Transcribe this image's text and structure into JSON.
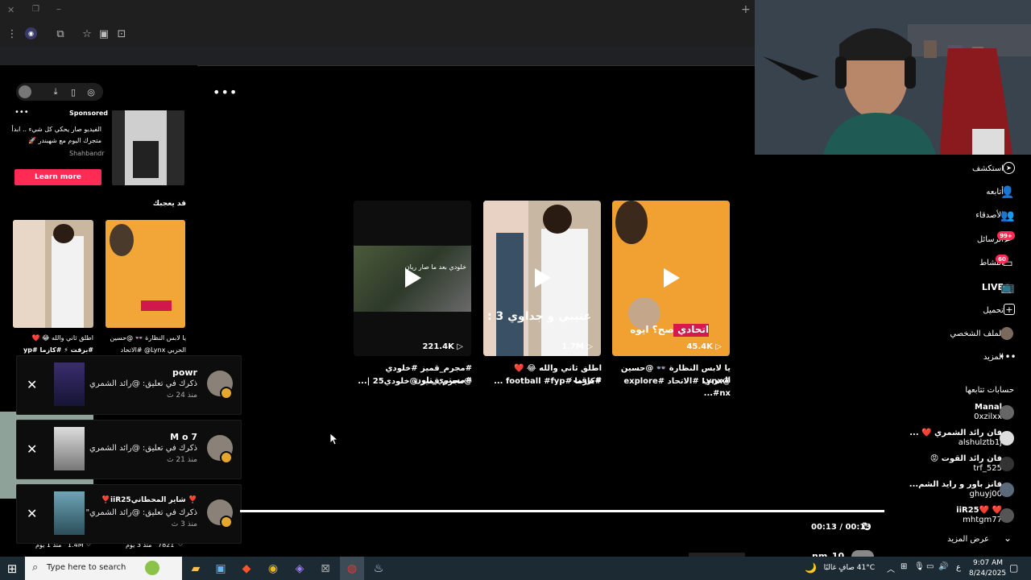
{
  "browser": {
    "toolbar_icons": [
      "menu-dots-icon",
      "profile-icon",
      "extensions-icon",
      "star-icon",
      "tab-search-icon",
      "screenshot-icon"
    ]
  },
  "left": {
    "sponsored_label": "Sponsored",
    "ad_text_line1": "الفيديو صار يحكي كل شيء .. ابدأ",
    "ad_text_line2": "متجرك اليوم مع شهبندر 🚀",
    "ad_brand": "Shahbandr",
    "learn_more": "Learn more",
    "you_may_like": "قد يعجبك",
    "small_cards": [
      {
        "caption_line1": "اطلق ثاني والله 😂 ❤️",
        "caption_line2": "#برقت ⚡ #كازما #yp"
      },
      {
        "caption_line1": "يا لابس النظارة 👓 @حسين",
        "caption_line2": "الحربي Lynx@ #الاتحاد"
      }
    ],
    "bottom_stats": [
      {
        "count": "1.4M",
        "age": "منذ 1 يوم"
      },
      {
        "count": "7821",
        "age": "منذ 3 يوم"
      }
    ]
  },
  "notifications": [
    {
      "name": "powr",
      "message": "ذكرك في تعليق: @رائد الشمري",
      "time": "منذ 24 ث"
    },
    {
      "name": "M o 7",
      "message": "ذكرك في تعليق: @رائد الشمري",
      "time": "منذ 21 ث"
    },
    {
      "name": "❣️iiR25شاير المحطاني ❣️",
      "message": "ذكرك في تعليق: @رائد الشمري\"",
      "time": "منذ 3 ث"
    }
  ],
  "videos": [
    {
      "views": "221.4K",
      "caption_line1": "#مجرم_قميز #خلودي #مستري_تاون",
      "caption_line2": "@مجرم قميز @خلودي25 |...",
      "overlay": "خلودي بعد ما صار ريان"
    },
    {
      "views": "1.7M",
      "caption_line1": "اطلق ثاني والله 😂 ❤️ #برقت⚡",
      "caption_line2": "#كازما #football #fyp ...",
      "overlay": "عتيبي و جداوي 3 :"
    },
    {
      "views": "45.4K",
      "caption_line1": "يا لابس النظارة 👓 @حسين الحربي",
      "caption_line2": "@Lynx #الاتحاد #explore #nx...",
      "overlay": "اتحادي صح؟ ايوه"
    }
  ],
  "player": {
    "time": "00:13 / 00:13",
    "bottom_name": "nm_10"
  },
  "nav": [
    {
      "label": "استكشف",
      "icon": "compass-icon"
    },
    {
      "label": "أتابعه",
      "icon": "user-follow-icon"
    },
    {
      "label": "الأصدقاء",
      "icon": "friends-icon"
    },
    {
      "label": "الرسائل",
      "icon": "messages-icon",
      "badge": "99+"
    },
    {
      "label": "النشاط",
      "icon": "activity-icon",
      "badge": "60"
    },
    {
      "label": "LIVE",
      "icon": "live-icon"
    },
    {
      "label": "تحميل",
      "icon": "upload-icon"
    },
    {
      "label": "الملف الشخصي",
      "icon": "profile-avatar-icon"
    },
    {
      "label": "المزيد",
      "icon": "more-icon"
    }
  ],
  "following": {
    "title": "حسابات تتابعها",
    "accounts": [
      {
        "name": "Manal",
        "user": "0xzilxx"
      },
      {
        "name": "فان رائد الشمري ❤️ ...",
        "user": "alshulztb1j"
      },
      {
        "name": "فان رائد القوت 😡",
        "user": "trf_525"
      },
      {
        "name": "فانز باور و رايد الشم...",
        "user": "ghuyj00"
      },
      {
        "name": "iiR25❤️ ❤️",
        "user": "mhtgm77"
      }
    ],
    "show_more": "عرض المزيد"
  },
  "taskbar": {
    "search_placeholder": "Type here to search",
    "weather": "41°C  صافٍ غالبًا",
    "time": "9:07 AM",
    "date": "8/24/2025",
    "lang": "ع"
  },
  "colors": {
    "accent": "#fe2c55",
    "taskbar": "#1c2a33"
  }
}
